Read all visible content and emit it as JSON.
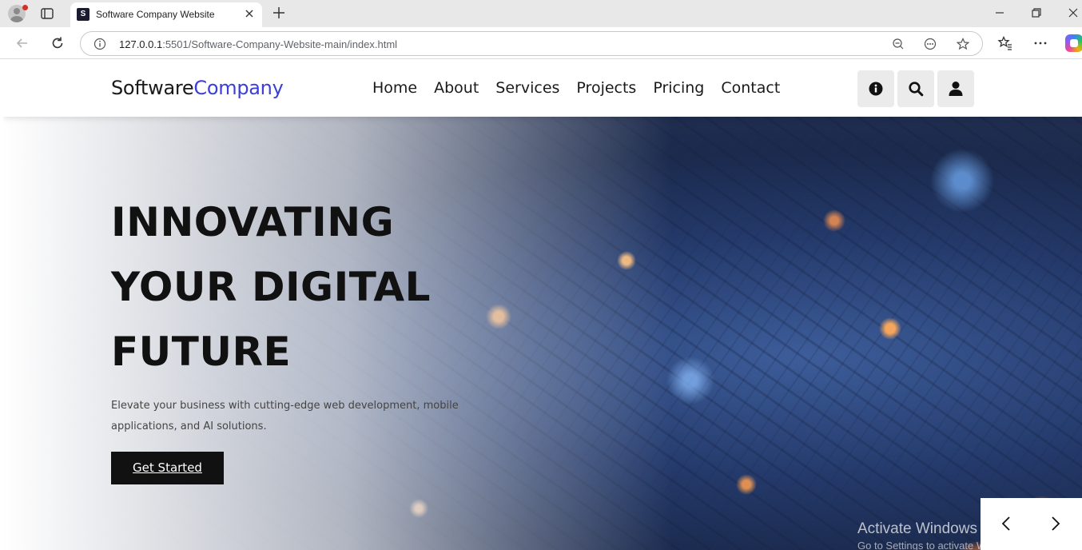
{
  "browser": {
    "tab_title": "Software Company Website",
    "url_host": "127.0.0.1",
    "url_rest": ":5501/Software-Company-Website-main/index.html"
  },
  "site": {
    "logo_primary": "Software",
    "logo_accent": "Company",
    "accent_color": "#3a3fd8",
    "nav": [
      "Home",
      "About",
      "Services",
      "Projects",
      "Pricing",
      "Contact"
    ],
    "header_icons": [
      "info-icon",
      "search-icon",
      "user-icon"
    ]
  },
  "hero": {
    "heading_lines": [
      "INNOVATING",
      "YOUR DIGITAL",
      "FUTURE"
    ],
    "subtitle": "Elevate your business with cutting-edge web development, mobile applications, and AI solutions.",
    "cta_label": "Get Started"
  },
  "overlay": {
    "watermark_title": "Activate Windows",
    "watermark_sub": "Go to Settings to activate Windows."
  }
}
